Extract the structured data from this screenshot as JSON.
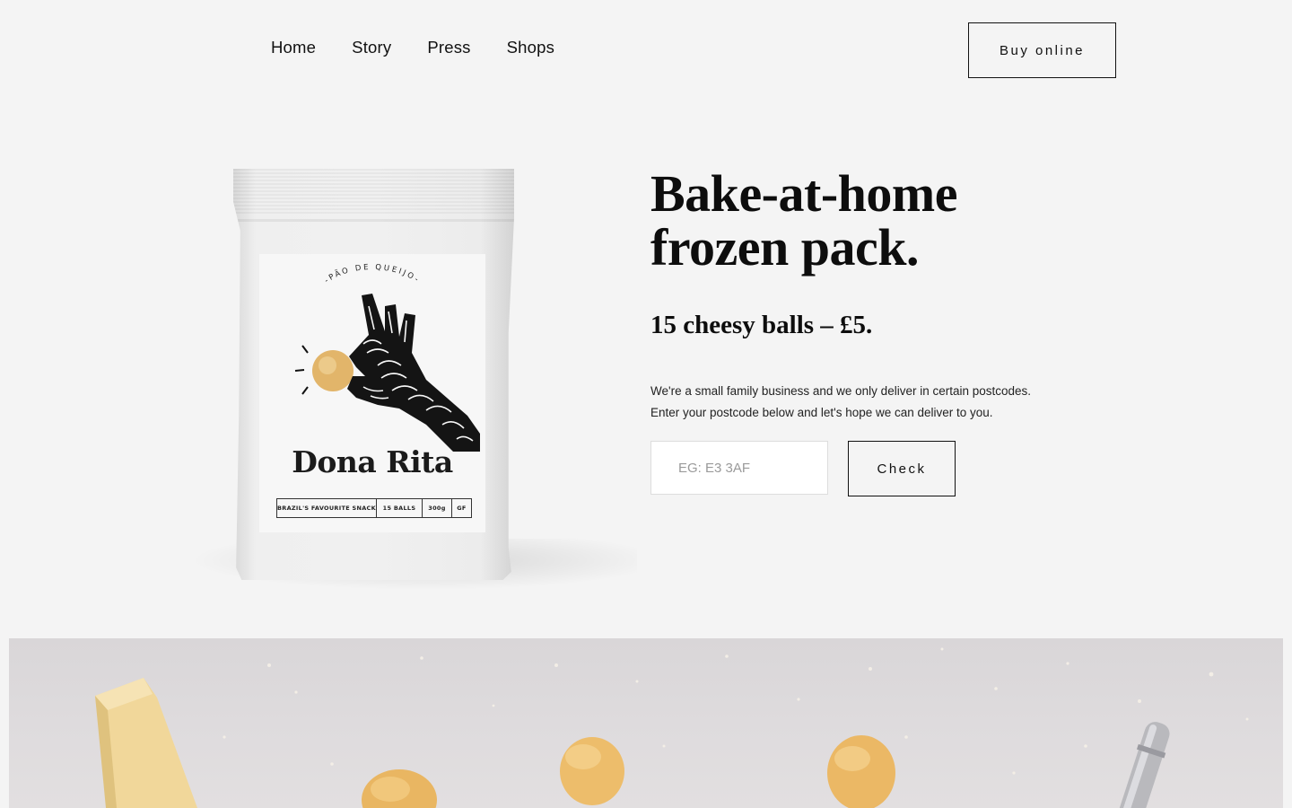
{
  "header": {
    "nav": [
      {
        "label": "Home"
      },
      {
        "label": "Story"
      },
      {
        "label": "Press"
      },
      {
        "label": "Shops"
      }
    ],
    "buy_label": "Buy online"
  },
  "product_pack": {
    "arc_text": "-PÃO DE QUEIJO-",
    "brand": "Dona Rita",
    "strip": [
      "BRAZIL'S FAVOURITE SNACK",
      "15 BALLS",
      "300g",
      "GF"
    ]
  },
  "hero": {
    "title_line1": "Bake-at-home",
    "title_line2": "frozen pack.",
    "subtitle": "15 cheesy balls – £5.",
    "description_line1": "We're a small family business and we only deliver in certain postcodes.",
    "description_line2": "Enter your postcode below and let's hope we can deliver to you.",
    "postcode_placeholder": "EG: E3 3AF",
    "postcode_value": "",
    "check_label": "Check"
  },
  "colors": {
    "background": "#f4f4f4",
    "text": "#111111",
    "accent_gold": "#d8a94f"
  }
}
